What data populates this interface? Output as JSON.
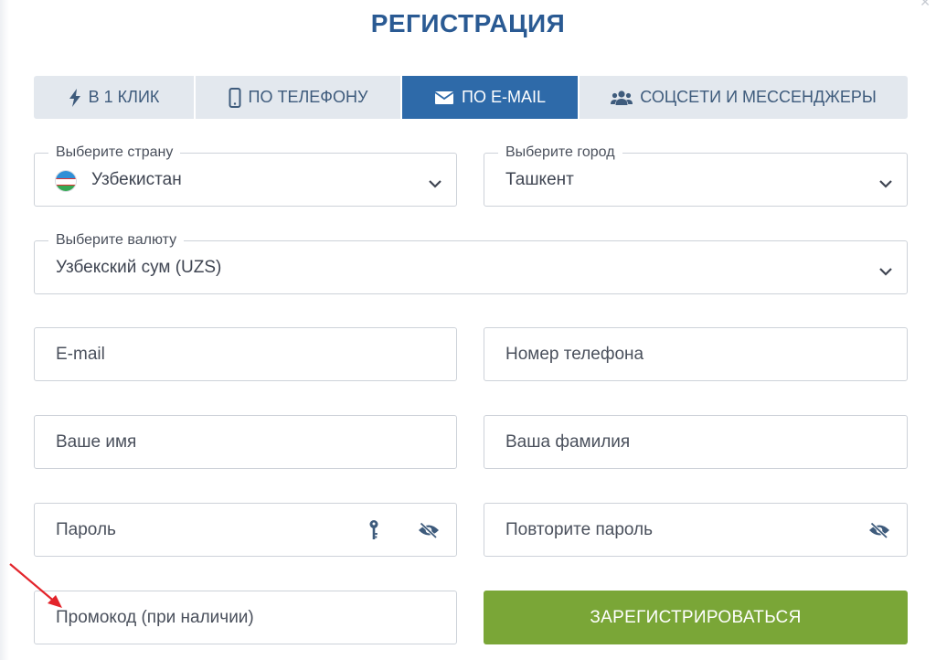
{
  "title": "РЕГИСТРАЦИЯ",
  "tabs": [
    {
      "label": "В 1 КЛИК",
      "icon": "lightning-icon",
      "active": false
    },
    {
      "label": "ПО ТЕЛЕФОНУ",
      "icon": "phone-icon",
      "active": false
    },
    {
      "label": "ПО E-MAIL",
      "icon": "envelope-icon",
      "active": true
    },
    {
      "label": "СОЦСЕТИ И МЕССЕНДЖЕРЫ",
      "icon": "users-icon",
      "active": false
    }
  ],
  "country": {
    "label": "Выберите страну",
    "value": "Узбекистан",
    "icon": "uzbekistan-flag-icon"
  },
  "city": {
    "label": "Выберите город",
    "value": "Ташкент"
  },
  "currency": {
    "label": "Выберите валюту",
    "value": "Узбекский сум (UZS)"
  },
  "email": {
    "placeholder": "E-mail"
  },
  "phone": {
    "placeholder": "Номер телефона"
  },
  "first_name": {
    "placeholder": "Ваше имя"
  },
  "last_name": {
    "placeholder": "Ваша фамилия"
  },
  "password": {
    "placeholder": "Пароль"
  },
  "password_repeat": {
    "placeholder": "Повторите пароль"
  },
  "promo": {
    "placeholder": "Промокод (при наличии)"
  },
  "register_button": {
    "label": "ЗАРЕГИСТРИРОВАТЬСЯ"
  },
  "colors": {
    "title": "#2a5a93",
    "tab_active": "#2e6aa9",
    "tab_inactive": "#e3e8ee",
    "button": "#7aa637",
    "annotation_arrow": "#e3242b"
  }
}
